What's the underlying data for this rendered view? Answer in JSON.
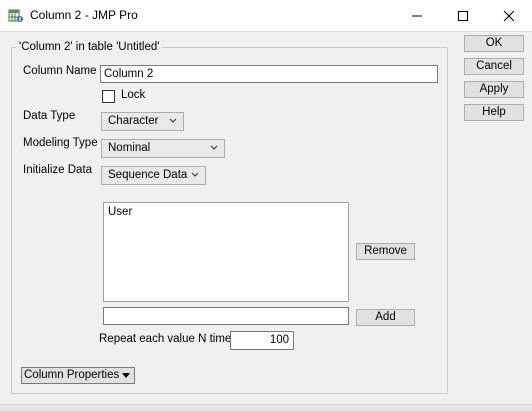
{
  "window": {
    "title": "Column 2 - JMP Pro",
    "icon": "jmp-column-info-icon",
    "controls": {
      "minimize": "minimize-icon",
      "maximize": "maximize-icon",
      "close": "close-icon"
    }
  },
  "group": {
    "legend": "'Column 2' in table 'Untitled'"
  },
  "form": {
    "column_name_label": "Column Name",
    "column_name_value": "Column 2",
    "lock_label": "Lock",
    "lock_checked": false,
    "data_type_label": "Data Type",
    "data_type_value": "Character",
    "modeling_type_label": "Modeling Type",
    "modeling_type_value": "Nominal",
    "initialize_data_label": "Initialize Data",
    "initialize_data_value": "Sequence Data",
    "list_items": [
      "User"
    ],
    "add_field_value": "",
    "remove_label": "Remove",
    "add_label": "Add",
    "repeat_label": "Repeat each value N times",
    "repeat_value": "100",
    "column_properties_label": "Column Properties"
  },
  "buttons": {
    "ok": "OK",
    "cancel": "Cancel",
    "apply": "Apply",
    "help": "Help"
  }
}
